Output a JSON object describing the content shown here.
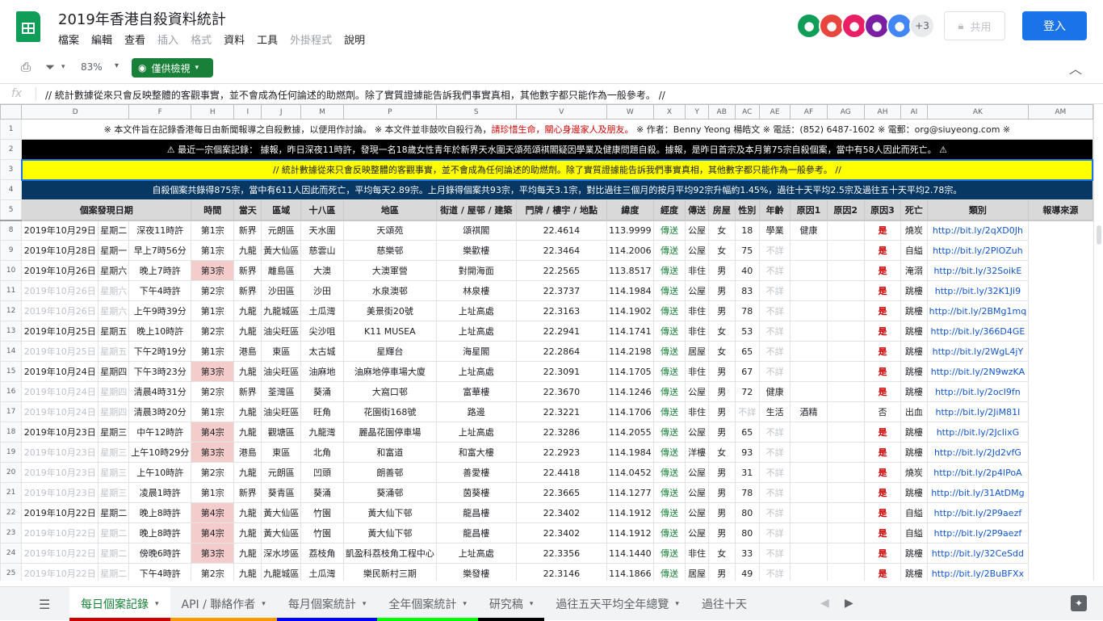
{
  "app": {
    "title": "2019年香港自殺資料統計",
    "menu": [
      "檔案",
      "編輯",
      "查看",
      "插入",
      "格式",
      "資料",
      "工具",
      "外掛程式",
      "說明"
    ],
    "menu_dim": [
      false,
      false,
      false,
      true,
      true,
      false,
      false,
      true,
      false
    ],
    "share_label": "共用",
    "login_label": "登入",
    "avatars_more": "+3",
    "avatar_colors": [
      "#0f9d58",
      "#e8453c",
      "#e91e63",
      "#7b1fa2",
      "#4285f4"
    ]
  },
  "toolbar": {
    "zoom": "83%",
    "view_only": "僅供檢視"
  },
  "formula": {
    "fx": "fx",
    "text": "// 統計數據從來只會反映整體的客觀事實，並不會成為任何論述的助燃劑。除了實質證據能告訴我們事實真相，其他數字都只能作為一般參考。 //"
  },
  "columns": [
    "",
    "D",
    "F",
    "H",
    "I",
    "J",
    "M",
    "P",
    "S",
    "V",
    "W",
    "X",
    "Y",
    "AB",
    "AC",
    "AE",
    "AF",
    "AG",
    "AH",
    "AI",
    "AK",
    "AM"
  ],
  "banners": {
    "r1_num": "1",
    "r1": "※ 本文件旨在記錄香港每日由新聞報導之自殺數據，以便用作討論。 ※ 本文件並非鼓吹自殺行為，",
    "r1_red": "請珍惜生命，關心身邊家人及朋友。",
    "r1_tail": " ※ 作者：Benny Yeong 楊皓文 ※ 電話：(852) 6487-1602 ※ 電郵：org@siuyeong.com ※",
    "r2_num": "2",
    "r2": "⚠ 最近一宗個案記錄： 據報，昨日深夜11時許，發現一名18歲女性青年於新界天水圍天頌苑頌祺閣疑因學業及健康問題自殺。據報，是昨日首宗及本月第75宗自殺個案，當中有58人因此而死亡。 ⚠",
    "r3_num": "3",
    "r3": "// 統計數據從來只會反映整體的客觀事實，並不會成為任何論述的助燃劑。除了實質證據能告訴我們事實真相，其他數字都只能作為一般參考。 //",
    "r4_num": "4",
    "r4": "自殺個案共錄得875宗，當中有611人因此而死亡，平均每天2.89宗。上月錄得個案共93宗，平均每天3.1宗，對比過往三個月的按月平均92宗升幅約1.45%，過往十天平均2.5宗及過往五十天平均2.78宗。"
  },
  "headers": {
    "row_num": "5",
    "labels": [
      "個案發現日期",
      "時間",
      "當天",
      "區域",
      "十八區",
      "地區",
      "街道 / 屋邨 / 建築",
      "門牌 / 樓宇 / 地點",
      "緯度",
      "經度",
      "傳送",
      "房屋",
      "性別",
      "年齡",
      "原因1",
      "原因2",
      "原因3",
      "死亡",
      "類別",
      "報導來源"
    ]
  },
  "rows": [
    {
      "n": "8",
      "date": "2019年10月29日",
      "wd": "星期二",
      "time": "深夜11時許",
      "day": "第1宗",
      "reg": "新界",
      "dist": "元朗區",
      "area": "天水圍",
      "street": "天頌苑",
      "bldg": "頌祺閣",
      "lat": "22.4614",
      "lng": "113.9999",
      "tx": "傳送",
      "house": "公屋",
      "sex": "女",
      "age": "18",
      "r1": "學業",
      "r2": "健康",
      "r3": "",
      "dead": "是",
      "cat": "燒炭",
      "src": "http://bit.ly/2qXD0Jh",
      "dimdate": false,
      "pink": false
    },
    {
      "n": "9",
      "date": "2019年10月28日",
      "wd": "星期一",
      "time": "早上7時56分",
      "day": "第1宗",
      "reg": "九龍",
      "dist": "黃大仙區",
      "area": "慈雲山",
      "street": "慈樂邨",
      "bldg": "樂歡樓",
      "lat": "22.3464",
      "lng": "114.2006",
      "tx": "傳送",
      "house": "公屋",
      "sex": "女",
      "age": "75",
      "r1": "不詳",
      "r2": "",
      "r3": "",
      "dead": "是",
      "cat": "自縊",
      "src": "http://bit.ly/2PlOZuh",
      "dimdate": false,
      "pink": false
    },
    {
      "n": "10",
      "date": "2019年10月26日",
      "wd": "星期六",
      "time": "晚上7時許",
      "day": "第3宗",
      "reg": "新界",
      "dist": "離島區",
      "area": "大澳",
      "street": "大澳軍營",
      "bldg": "對開海面",
      "lat": "22.2565",
      "lng": "113.8517",
      "tx": "傳送",
      "house": "非住",
      "sex": "男",
      "age": "40",
      "r1": "不詳",
      "r2": "",
      "r3": "",
      "dead": "是",
      "cat": "淹溺",
      "src": "http://bit.ly/32SoikE",
      "dimdate": false,
      "pink": true
    },
    {
      "n": "11",
      "date": "2019年10月26日",
      "wd": "星期六",
      "time": "下午4時許",
      "day": "第2宗",
      "reg": "新界",
      "dist": "沙田區",
      "area": "沙田",
      "street": "水泉澳邨",
      "bldg": "林泉樓",
      "lat": "22.3737",
      "lng": "114.1984",
      "tx": "傳送",
      "house": "公屋",
      "sex": "男",
      "age": "83",
      "r1": "不詳",
      "r2": "",
      "r3": "",
      "dead": "是",
      "cat": "跳樓",
      "src": "http://bit.ly/32K1Ji9",
      "dimdate": true,
      "pink": false
    },
    {
      "n": "12",
      "date": "2019年10月26日",
      "wd": "星期六",
      "time": "上午9時39分",
      "day": "第1宗",
      "reg": "九龍",
      "dist": "九龍城區",
      "area": "土瓜灣",
      "street": "美景街20號",
      "bldg": "上址高處",
      "lat": "22.3163",
      "lng": "114.1902",
      "tx": "傳送",
      "house": "非住",
      "sex": "男",
      "age": "78",
      "r1": "不詳",
      "r2": "",
      "r3": "",
      "dead": "是",
      "cat": "跳樓",
      "src": "http://bit.ly/2BMg1mq",
      "dimdate": true,
      "pink": false
    },
    {
      "n": "13",
      "date": "2019年10月25日",
      "wd": "星期五",
      "time": "晚上10時許",
      "day": "第2宗",
      "reg": "九龍",
      "dist": "油尖旺區",
      "area": "尖沙咀",
      "street": "K11 MUSEA",
      "bldg": "上址高處",
      "lat": "22.2941",
      "lng": "114.1741",
      "tx": "傳送",
      "house": "非住",
      "sex": "女",
      "age": "53",
      "r1": "不詳",
      "r2": "",
      "r3": "",
      "dead": "是",
      "cat": "跳樓",
      "src": "http://bit.ly/366D4GE",
      "dimdate": false,
      "pink": false
    },
    {
      "n": "14",
      "date": "2019年10月25日",
      "wd": "星期五",
      "time": "下午2時19分",
      "day": "第1宗",
      "reg": "港島",
      "dist": "東區",
      "area": "太古城",
      "street": "星輝台",
      "bldg": "海星閣",
      "lat": "22.2864",
      "lng": "114.2198",
      "tx": "傳送",
      "house": "居屋",
      "sex": "女",
      "age": "65",
      "r1": "不詳",
      "r2": "",
      "r3": "",
      "dead": "是",
      "cat": "跳樓",
      "src": "http://bit.ly/2WgL4jY",
      "dimdate": true,
      "pink": false
    },
    {
      "n": "15",
      "date": "2019年10月24日",
      "wd": "星期四",
      "time": "下午3時23分",
      "day": "第3宗",
      "reg": "九龍",
      "dist": "油尖旺區",
      "area": "油麻地",
      "street": "油麻地停車場大廈",
      "bldg": "上址高處",
      "lat": "22.3091",
      "lng": "114.1705",
      "tx": "傳送",
      "house": "非住",
      "sex": "男",
      "age": "67",
      "r1": "不詳",
      "r2": "",
      "r3": "",
      "dead": "是",
      "cat": "跳樓",
      "src": "http://bit.ly/2N9wzKA",
      "dimdate": false,
      "pink": true
    },
    {
      "n": "16",
      "date": "2019年10月24日",
      "wd": "星期四",
      "time": "清晨4時31分",
      "day": "第2宗",
      "reg": "新界",
      "dist": "荃灣區",
      "area": "葵涌",
      "street": "大窩口邨",
      "bldg": "富華樓",
      "lat": "22.3670",
      "lng": "114.1246",
      "tx": "傳送",
      "house": "公屋",
      "sex": "男",
      "age": "72",
      "r1": "健康",
      "r2": "",
      "r3": "",
      "dead": "是",
      "cat": "跳樓",
      "src": "http://bit.ly/2ocI9fn",
      "dimdate": true,
      "pink": false
    },
    {
      "n": "17",
      "date": "2019年10月24日",
      "wd": "星期四",
      "time": "清晨3時20分",
      "day": "第1宗",
      "reg": "九龍",
      "dist": "油尖旺區",
      "area": "旺角",
      "street": "花園街168號",
      "bldg": "路邊",
      "lat": "22.3221",
      "lng": "114.1706",
      "tx": "傳送",
      "house": "非住",
      "sex": "男",
      "age": "不詳",
      "r1": "生活",
      "r2": "酒精",
      "r3": "",
      "dead": "否",
      "cat": "出血",
      "src": "http://bit.ly/2JiM81I",
      "dimdate": true,
      "pink": false
    },
    {
      "n": "18",
      "date": "2019年10月23日",
      "wd": "星期三",
      "time": "中午12時許",
      "day": "第4宗",
      "reg": "九龍",
      "dist": "觀塘區",
      "area": "九龍灣",
      "street": "麗晶花園停車場",
      "bldg": "上址高處",
      "lat": "22.3286",
      "lng": "114.2055",
      "tx": "傳送",
      "house": "公屋",
      "sex": "男",
      "age": "65",
      "r1": "不詳",
      "r2": "",
      "r3": "",
      "dead": "是",
      "cat": "跳樓",
      "src": "http://bit.ly/2JcIixG",
      "dimdate": false,
      "pink": true
    },
    {
      "n": "19",
      "date": "2019年10月23日",
      "wd": "星期三",
      "time": "上午10時29分",
      "day": "第3宗",
      "reg": "港島",
      "dist": "東區",
      "area": "北角",
      "street": "和富道",
      "bldg": "和富大樓",
      "lat": "22.2923",
      "lng": "114.1984",
      "tx": "傳送",
      "house": "洋樓",
      "sex": "女",
      "age": "93",
      "r1": "不詳",
      "r2": "",
      "r3": "",
      "dead": "是",
      "cat": "跳樓",
      "src": "http://bit.ly/2Jd2vfG",
      "dimdate": true,
      "pink": true
    },
    {
      "n": "20",
      "date": "2019年10月23日",
      "wd": "星期三",
      "time": "上午10時許",
      "day": "第2宗",
      "reg": "九龍",
      "dist": "元朗區",
      "area": "凹頭",
      "street": "朗善邨",
      "bldg": "善愛樓",
      "lat": "22.4418",
      "lng": "114.0452",
      "tx": "傳送",
      "house": "公屋",
      "sex": "男",
      "age": "31",
      "r1": "不詳",
      "r2": "",
      "r3": "",
      "dead": "是",
      "cat": "燒炭",
      "src": "http://bit.ly/2p4lPoA",
      "dimdate": true,
      "pink": false
    },
    {
      "n": "21",
      "date": "2019年10月23日",
      "wd": "星期三",
      "time": "凌晨1時許",
      "day": "第1宗",
      "reg": "新界",
      "dist": "葵青區",
      "area": "葵涌",
      "street": "葵涌邨",
      "bldg": "茵葵樓",
      "lat": "22.3665",
      "lng": "114.1277",
      "tx": "傳送",
      "house": "公屋",
      "sex": "男",
      "age": "78",
      "r1": "不詳",
      "r2": "",
      "r3": "",
      "dead": "是",
      "cat": "跳樓",
      "src": "http://bit.ly/31AtDMg",
      "dimdate": true,
      "pink": false
    },
    {
      "n": "22",
      "date": "2019年10月22日",
      "wd": "星期二",
      "time": "晚上8時許",
      "day": "第4宗",
      "reg": "九龍",
      "dist": "黃大仙區",
      "area": "竹園",
      "street": "黃大仙下邨",
      "bldg": "龍昌樓",
      "lat": "22.3402",
      "lng": "114.1912",
      "tx": "傳送",
      "house": "公屋",
      "sex": "男",
      "age": "80",
      "r1": "不詳",
      "r2": "",
      "r3": "",
      "dead": "是",
      "cat": "自縊",
      "src": "http://bit.ly/2P9aezf",
      "dimdate": false,
      "pink": true
    },
    {
      "n": "23",
      "date": "2019年10月22日",
      "wd": "星期二",
      "time": "晚上8時許",
      "day": "第4宗",
      "reg": "九龍",
      "dist": "黃大仙區",
      "area": "竹園",
      "street": "黃大仙下邨",
      "bldg": "龍昌樓",
      "lat": "22.3402",
      "lng": "114.1912",
      "tx": "傳送",
      "house": "公屋",
      "sex": "男",
      "age": "80",
      "r1": "不詳",
      "r2": "",
      "r3": "",
      "dead": "是",
      "cat": "自縊",
      "src": "http://bit.ly/2P9aezf",
      "dimdate": true,
      "pink": true
    },
    {
      "n": "24",
      "date": "2019年10月22日",
      "wd": "星期二",
      "time": "傍晚6時許",
      "day": "第3宗",
      "reg": "九龍",
      "dist": "深水埗區",
      "area": "荔枝角",
      "street": "凱盈科荔枝角工程中心",
      "bldg": "上址高處",
      "lat": "22.3356",
      "lng": "114.1440",
      "tx": "傳送",
      "house": "非住",
      "sex": "女",
      "age": "33",
      "r1": "不詳",
      "r2": "",
      "r3": "",
      "dead": "是",
      "cat": "跳樓",
      "src": "http://bit.ly/32CeSdd",
      "dimdate": true,
      "pink": true
    },
    {
      "n": "25",
      "date": "2019年10月22日",
      "wd": "星期二",
      "time": "下午4時許",
      "day": "第2宗",
      "reg": "九龍",
      "dist": "九龍城區",
      "area": "土瓜灣",
      "street": "樂民新村三期",
      "bldg": "樂發樓",
      "lat": "22.3146",
      "lng": "114.1866",
      "tx": "傳送",
      "house": "居屋",
      "sex": "男",
      "age": "49",
      "r1": "不詳",
      "r2": "",
      "r3": "",
      "dead": "是",
      "cat": "跳樓",
      "src": "http://bit.ly/2BuBFXx",
      "dimdate": true,
      "pink": false
    }
  ],
  "tabs": [
    {
      "label": "每日個案記錄",
      "color": "#cc0000",
      "active": true
    },
    {
      "label": "API / 聯絡作者",
      "color": "#ff9900",
      "active": false
    },
    {
      "label": "每月個案統計",
      "color": "#0000ff",
      "active": false
    },
    {
      "label": "全年個案統計",
      "color": "#00ff00",
      "active": false
    },
    {
      "label": "研究稿",
      "color": "#000000",
      "active": false
    },
    {
      "label": "過往五天平均全年總覽",
      "color": "",
      "active": false
    },
    {
      "label": "過往十天",
      "color": "",
      "active": false
    }
  ]
}
